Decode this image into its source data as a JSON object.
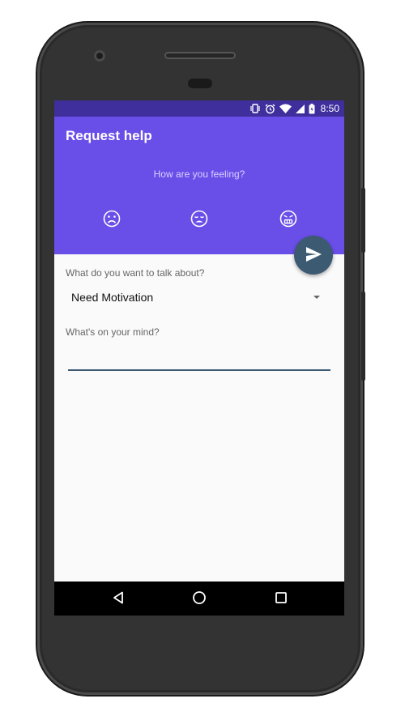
{
  "status_bar": {
    "time": "8:50",
    "icons": [
      "vibrate-icon",
      "alarm-icon",
      "wifi-icon",
      "signal-icon",
      "battery-icon"
    ],
    "background": "#3f2f9c"
  },
  "app_bar": {
    "title": "Request help",
    "prompt": "How are you feeling?",
    "moods": [
      "sad-face-icon",
      "tired-face-icon",
      "angry-face-icon"
    ],
    "background": "#6a4ee8"
  },
  "fab": {
    "icon": "send-icon",
    "color": "#3d5a73"
  },
  "form": {
    "topic_label": "What do you want to talk about?",
    "topic_value": "Need Motivation",
    "mind_label": "What's on your mind?",
    "mind_value": ""
  },
  "nav_bar": {
    "icons": [
      "back-icon",
      "home-icon",
      "recents-icon"
    ]
  }
}
